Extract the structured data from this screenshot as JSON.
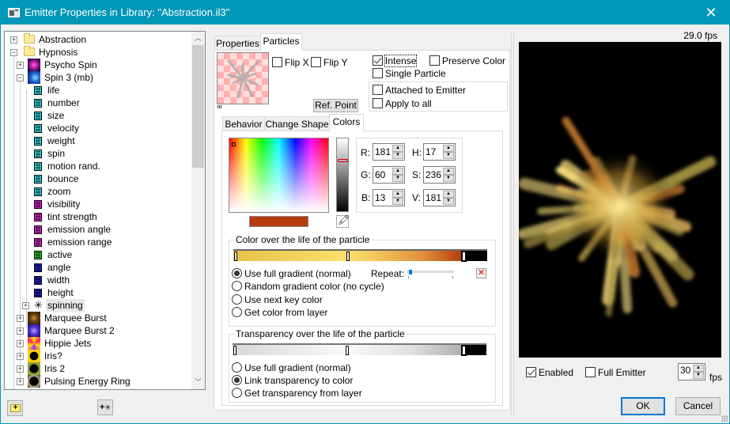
{
  "window": {
    "title": "Emitter Properties in Library: \"Abstraction.il3\"",
    "close_icon": "close-icon"
  },
  "tree": {
    "items": [
      {
        "label": "Abstraction",
        "type": "folder",
        "expander": "+"
      },
      {
        "label": "Hypnosis",
        "type": "folder",
        "expander": "−"
      },
      {
        "label": "Psycho Spin",
        "type": "emitter",
        "expander": "+"
      },
      {
        "label": "Spin 3 (mb)",
        "type": "emitter",
        "expander": "−"
      },
      {
        "label": "life",
        "type": "property",
        "color": "#2fe0e8"
      },
      {
        "label": "number",
        "type": "property",
        "color": "#2fe0e8"
      },
      {
        "label": "size",
        "type": "property",
        "color": "#2fe0e8"
      },
      {
        "label": "velocity",
        "type": "property",
        "color": "#2fe0e8"
      },
      {
        "label": "weight",
        "type": "property",
        "color": "#2fe0e8"
      },
      {
        "label": "spin",
        "type": "property",
        "color": "#2fe0e8"
      },
      {
        "label": "motion rand.",
        "type": "property",
        "color": "#2fe0e8"
      },
      {
        "label": "bounce",
        "type": "property",
        "color": "#2fe0e8"
      },
      {
        "label": "zoom",
        "type": "property",
        "color": "#2fe0e8"
      },
      {
        "label": "visibility",
        "type": "property",
        "color": "#e020d8"
      },
      {
        "label": "tint strength",
        "type": "property",
        "color": "#e020d8"
      },
      {
        "label": "emission angle",
        "type": "property",
        "color": "#e020d8"
      },
      {
        "label": "emission range",
        "type": "property",
        "color": "#e020d8"
      },
      {
        "label": "active",
        "type": "property",
        "color": "#20d020"
      },
      {
        "label": "angle",
        "type": "property",
        "color": "#2020d0"
      },
      {
        "label": "width",
        "type": "property",
        "color": "#2020d0"
      },
      {
        "label": "height",
        "type": "property",
        "color": "#2020d0"
      },
      {
        "label": "spinning",
        "type": "particle",
        "expander": "+"
      },
      {
        "label": "Marquee Burst",
        "type": "emitter",
        "expander": "+"
      },
      {
        "label": "Marquee Burst 2",
        "type": "emitter",
        "expander": "+"
      },
      {
        "label": "Hippie Jets",
        "type": "emitter",
        "expander": "+"
      },
      {
        "label": "Iris?",
        "type": "emitter",
        "expander": "+"
      },
      {
        "label": "Iris 2",
        "type": "emitter",
        "expander": "+"
      },
      {
        "label": "Pulsing Energy Ring",
        "type": "emitter",
        "expander": "+"
      }
    ],
    "new_folder_icon": "new-folder-icon",
    "new_particle_icon": "new-particle-icon"
  },
  "tabs": {
    "main": [
      {
        "label": "Properties"
      },
      {
        "label": "Particles",
        "active": true
      }
    ],
    "sub": [
      {
        "label": "Behavior"
      },
      {
        "label": "Change Shape"
      },
      {
        "label": "Colors",
        "active": true
      }
    ]
  },
  "particles": {
    "flip_x": {
      "label": "Flip X",
      "checked": false
    },
    "flip_y": {
      "label": "Flip Y",
      "checked": false
    },
    "intense": {
      "label": "Intense",
      "checked": true
    },
    "preserve_color": {
      "label": "Preserve Color",
      "checked": false
    },
    "single_particle": {
      "label": "Single Particle",
      "checked": false
    },
    "attached": {
      "label": "Attached to Emitter",
      "checked": false
    },
    "apply_all": {
      "label": "Apply to all",
      "checked": false
    },
    "ref_point": "Ref. Point"
  },
  "colors": {
    "current_color": "#b53c0d",
    "r": {
      "label": "R:",
      "value": "181"
    },
    "g": {
      "label": "G:",
      "value": "60"
    },
    "b": {
      "label": "B:",
      "value": "13"
    },
    "h": {
      "label": "H:",
      "value": "17"
    },
    "s": {
      "label": "S:",
      "value": "236"
    },
    "v": {
      "label": "V:",
      "value": "181"
    },
    "color_life": {
      "title": "Color over the life of the particle",
      "options": [
        {
          "label": "Use full gradient (normal)",
          "selected": true
        },
        {
          "label": "Random gradient color (no cycle)",
          "selected": false
        },
        {
          "label": "Use next key color",
          "selected": false
        },
        {
          "label": "Get color from layer",
          "selected": false
        }
      ],
      "repeat_label": "Repeat:",
      "repeat_value": 0.05,
      "gradient_stops": [
        "#e8c24a",
        "#f9e06a",
        "#f5c860",
        "#e0903a",
        "#b53c0d"
      ]
    },
    "transparency_life": {
      "title": "Transparency over the life of the particle",
      "options": [
        {
          "label": "Use full gradient (normal)",
          "selected": false
        },
        {
          "label": "Link transparency to color",
          "selected": true
        },
        {
          "label": "Get transparency from layer",
          "selected": false
        }
      ]
    }
  },
  "preview": {
    "fps_readout": "29.0 fps",
    "enabled": {
      "label": "Enabled",
      "checked": true
    },
    "full_emitter": {
      "label": "Full Emitter",
      "checked": false
    },
    "fps_value": "30",
    "fps_unit": "fps"
  },
  "buttons": {
    "ok": "OK",
    "cancel": "Cancel"
  }
}
